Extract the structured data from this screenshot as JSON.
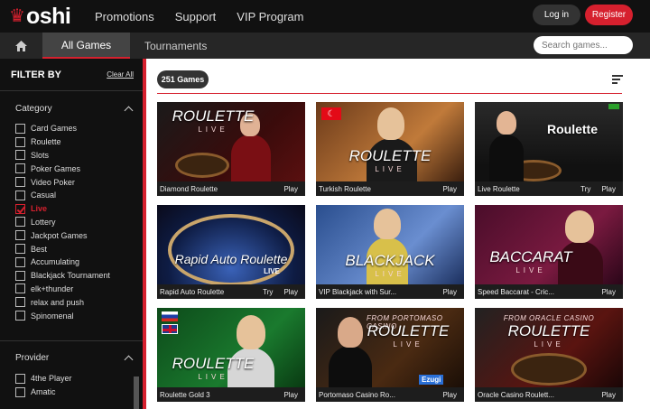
{
  "header": {
    "logo_text": "oshi",
    "nav": [
      "Promotions",
      "Support",
      "VIP Program"
    ],
    "login_label": "Log in",
    "register_label": "Register"
  },
  "tabs": {
    "all_games": "All Games",
    "tournaments": "Tournaments",
    "search_placeholder": "Search games..."
  },
  "sidebar": {
    "filter_title": "FILTER BY",
    "clear_all": "Clear All",
    "category_title": "Category",
    "categories": [
      {
        "label": "Card Games",
        "checked": false
      },
      {
        "label": "Roulette",
        "checked": false
      },
      {
        "label": "Slots",
        "checked": false
      },
      {
        "label": "Poker Games",
        "checked": false
      },
      {
        "label": "Video Poker",
        "checked": false
      },
      {
        "label": "Casual",
        "checked": false
      },
      {
        "label": "Live",
        "checked": true
      },
      {
        "label": "Lottery",
        "checked": false
      },
      {
        "label": "Jackpot Games",
        "checked": false
      },
      {
        "label": "Best",
        "checked": false
      },
      {
        "label": "Accumulating",
        "checked": false
      },
      {
        "label": "Blackjack Tournament",
        "checked": false
      },
      {
        "label": "elk+thunder",
        "checked": false
      },
      {
        "label": "relax and push",
        "checked": false
      },
      {
        "label": "Spinomenal",
        "checked": false
      }
    ],
    "provider_title": "Provider",
    "providers": [
      {
        "label": "4the Player",
        "checked": false
      },
      {
        "label": "Amatic",
        "checked": false
      }
    ]
  },
  "main": {
    "games_count": "251 Games",
    "games": [
      {
        "title": "Diamond Roulette",
        "banner": "ROULETTE",
        "sub": "LIVE",
        "try": "",
        "play": "Play"
      },
      {
        "title": "Turkish Roulette",
        "banner": "ROULETTE",
        "sub": "LIVE",
        "try": "",
        "play": "Play"
      },
      {
        "title": "Live Roulette",
        "banner": "Roulette",
        "sub": "",
        "try": "Try",
        "play": "Play"
      },
      {
        "title": "Rapid Auto Roulette",
        "banner": "Rapid Auto Roulette",
        "sub": "LIVE",
        "try": "Try",
        "play": "Play"
      },
      {
        "title": "VIP Blackjack with Sur...",
        "banner": "BLACKJACK",
        "sub": "LIVE",
        "try": "",
        "play": "Play"
      },
      {
        "title": "Speed Baccarat - Cric...",
        "banner": "BACCARAT",
        "sub": "LIVE",
        "try": "",
        "play": "Play"
      },
      {
        "title": "Roulette Gold 3",
        "banner": "ROULETTE",
        "sub": "LIVE",
        "try": "",
        "play": "Play"
      },
      {
        "title": "Portomaso Casino Ro...",
        "banner": "ROULETTE",
        "sub": "LIVE",
        "kicker": "FROM PORTOMASO CASINO",
        "brand": "Ezugi",
        "try": "",
        "play": "Play"
      },
      {
        "title": "Oracle Casino Roulett...",
        "banner": "ROULETTE",
        "sub": "LIVE",
        "kicker": "FROM ORACLE CASINO",
        "try": "",
        "play": "Play"
      }
    ]
  }
}
